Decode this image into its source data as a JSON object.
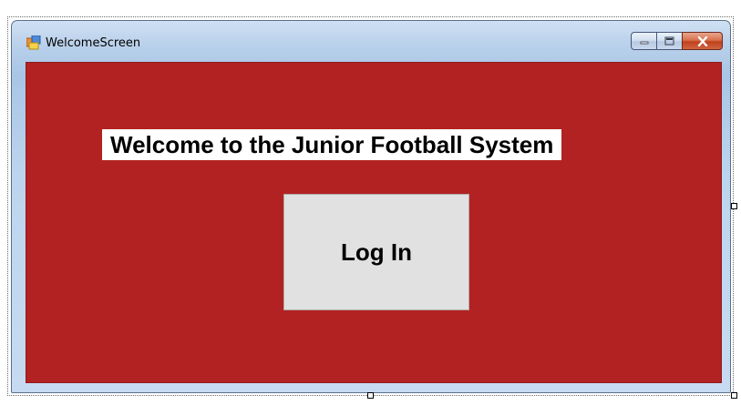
{
  "window": {
    "title": "WelcomeScreen",
    "app_icon": "winforms-form-icon"
  },
  "caption_buttons": {
    "minimize_icon": "minimize-icon",
    "maximize_icon": "maximize-icon",
    "close_icon": "close-icon"
  },
  "form": {
    "background_color": "#b22222",
    "welcome_text": "Welcome to the Junior Football System",
    "login_label": "Log In"
  },
  "designer": {
    "resize_handles": [
      "right-handle",
      "bottom-handle",
      "corner-handle"
    ]
  }
}
